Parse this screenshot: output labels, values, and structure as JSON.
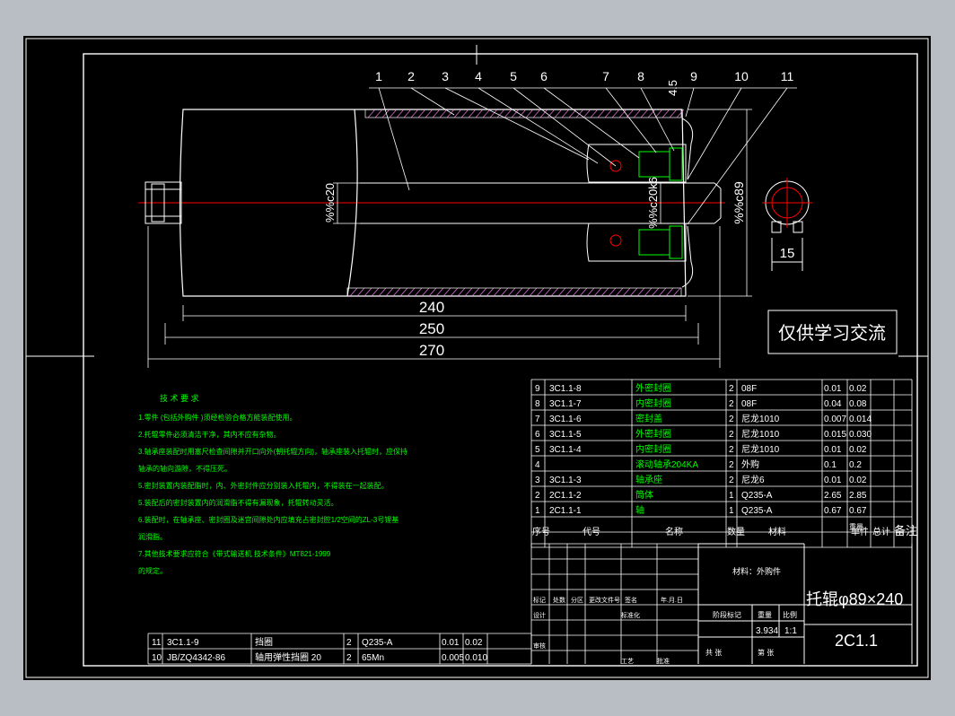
{
  "balloons": [
    "1",
    "2",
    "3",
    "4",
    "5",
    "6",
    "7",
    "8",
    "9",
    "10",
    "11"
  ],
  "dims": {
    "gap": "4.5",
    "shaft_dia": "%%c20",
    "bore_dia": "%%c20k6",
    "outer_dia": "%%c89",
    "side_width": "15",
    "l240": "240",
    "l250": "250",
    "l270": "270"
  },
  "watermark": "仅供学习交流",
  "notes": {
    "title": "技 术 要 求",
    "lines": [
      "1.零件 (包括外购件 )须经检验合格方能装配使用。",
      "2.托辊零件必须清洁干净，其内不应有杂物。",
      "3.轴承座装配时用塞尺检查间隙并开口向外(朝托辊方向)，轴承座装入托辊时，应保持",
      "轴承的轴向游隙，不得压死。",
      "5.密封装置内装配脂时，内、外密封件应分别装入托辊内，不得装在一起装配。",
      "5.装配后的密封装置内的润滑脂不得有漏现象，托辊转动灵活。",
      "6.装配时，在轴承座、密封圈及迷宫间隙处内应填充占密封腔1/2空间的ZL-3号锂基",
      "润滑脂。",
      "7.其他技术要求应符合《带式输送机 技术条件》MT821-1999",
      "的规定。"
    ]
  },
  "bom_upper": {
    "rows": [
      [
        "9",
        "3C1.1-8",
        "外密封圈",
        "2",
        "08F",
        "0.01",
        "0.02"
      ],
      [
        "8",
        "3C1.1-7",
        "内密封圈",
        "2",
        "08F",
        "0.04",
        "0.08"
      ],
      [
        "7",
        "3C1.1-6",
        "密封盖",
        "2",
        "尼龙1010",
        "0.007",
        "0.014"
      ],
      [
        "6",
        "3C1.1-5",
        "外密封圈",
        "2",
        "尼龙1010",
        "0.015",
        "0.030"
      ],
      [
        "5",
        "3C1.1-4",
        "内密封圈",
        "2",
        "尼龙1010",
        "0.01",
        "0.02"
      ],
      [
        "4",
        "",
        "滚动轴承204KA",
        "2",
        "外购",
        "0.1",
        "0.2"
      ],
      [
        "3",
        "3C1.1-3",
        "轴承座",
        "2",
        "尼龙6",
        "0.01",
        "0.02"
      ],
      [
        "2",
        "2C1.1-2",
        "筒体",
        "1",
        "Q235-A",
        "2.65",
        "2.85"
      ],
      [
        "1",
        "2C1.1-1",
        "轴",
        "1",
        "Q235-A",
        "0.67",
        "0.67"
      ]
    ],
    "header": [
      "序号",
      "代号",
      "名称",
      "数量",
      "材料",
      "单件",
      "总计",
      "备注"
    ],
    "header_sub": "重量"
  },
  "bom_lower": {
    "rows": [
      [
        "11",
        "3C1.1-9",
        "挡圈",
        "2",
        "Q235-A",
        "0.01",
        "0.02"
      ],
      [
        "10",
        "JB/ZQ4342-86",
        "轴用弹性挡圈 20",
        "2",
        "65Mn",
        "0.005",
        "0.010"
      ]
    ]
  },
  "title_block": {
    "part_name": "托辊φ89×240",
    "drawing_no": "2C1.1",
    "material_label": "材料：外购件",
    "mark_label": "标记",
    "count_label": "处数",
    "zone_label": "分区",
    "change_label": "更改文件号",
    "sign_label": "签名",
    "date_label": "年.月.日",
    "design_label": "设计",
    "standard_label": "标准化",
    "stage_label": "阶段标记",
    "weight_label": "重量",
    "scale_label": "比例",
    "weight": "3.934",
    "scale": "1:1",
    "review_label": "审核",
    "process_label": "工艺",
    "approve_label": "批准",
    "sheets_label": "共 张",
    "sheet_label": "第 张"
  },
  "colors": {
    "line": "#ffffff",
    "green": "#00ff00",
    "red": "#ff0000",
    "yellow": "#ffff00",
    "cyan": "#00ffff",
    "hatch": "#ff80ff"
  }
}
